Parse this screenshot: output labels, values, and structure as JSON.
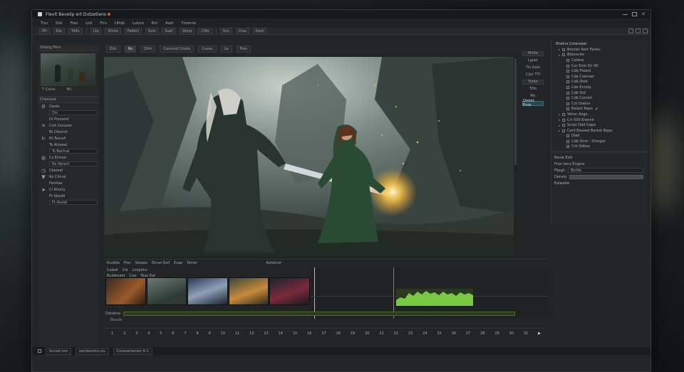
{
  "window": {
    "title": "Flevit Bevelip ert Dutzetiens"
  },
  "menu": [
    "Tlvs",
    "Sirk",
    "Ftes",
    "Lnd",
    "Ftrs",
    "Llfntb",
    "Lulzce",
    "Rnt",
    "Avet",
    "Tmenne"
  ],
  "toolbar": [
    "Pfr",
    "Ear",
    "Tofts",
    "Lta",
    "Dlvist",
    "Fedbrt",
    "Ssre",
    "Suer",
    "Qonp",
    "Ctlle",
    "Sns",
    "Ctse",
    "Dest"
  ],
  "left_panel": {
    "header": "Vilsing Pitro",
    "thumb_caption": [
      "T Cavle",
      "Bit"
    ],
    "section_title": "Chesrard",
    "rows": [
      {
        "icon": "settings-icon",
        "label": "Geole"
      },
      {
        "icon": "",
        "label": "Dis"
      },
      {
        "icon": "",
        "label": "Dl Prevaird"
      },
      {
        "icon": "wand-icon",
        "label": "Coit Cevazec"
      },
      {
        "icon": "",
        "label": "Bt Ditemrt"
      },
      {
        "icon": "refresh-icon",
        "label": "Rt Teorall"
      },
      {
        "icon": "",
        "label": "Ta Aloseet"
      },
      {
        "icon": "",
        "label": "Ts Bertnal"
      },
      {
        "icon": "chat-icon",
        "label": "Cs Eirtoal"
      },
      {
        "icon": "",
        "label": "Ro Sbrant"
      },
      {
        "icon": "clock-icon",
        "label": "Cbereel"
      },
      {
        "icon": "shield-icon",
        "label": "Ro Clirnal"
      },
      {
        "icon": "",
        "label": "Fenitaa"
      },
      {
        "icon": "pin-icon",
        "label": "Cl Ahorly"
      },
      {
        "icon": "",
        "label": "Ft Sbodd"
      },
      {
        "icon": "",
        "label": "Ft Aosist"
      }
    ]
  },
  "viewer": {
    "tabs": [
      "Edir",
      "Ro",
      "Dirtr",
      "Cannnid Cnatic",
      "Cavec",
      "Le",
      "Fres"
    ],
    "active_tab": 1
  },
  "tool_column": [
    "Pinite",
    "Lgoer",
    "Tiu Eavt",
    "Cjisr TTl",
    "Turso",
    "Tilfs",
    "Mx",
    "Dmmt Enre"
  ],
  "right_panel": {
    "header": "Ehehrs Cntersdet",
    "tree": [
      {
        "depth": 1,
        "label": "Brevier Aert Farets"
      },
      {
        "depth": 1,
        "label": "Bdevente"
      },
      {
        "depth": 2,
        "label": "Coldne"
      },
      {
        "depth": 2,
        "label": "Cor Eoio Str 40"
      },
      {
        "depth": 2,
        "label": "Cdb Fteeid"
      },
      {
        "depth": 2,
        "label": "Cde Coenser"
      },
      {
        "depth": 2,
        "label": "Cdb Dleit"
      },
      {
        "depth": 2,
        "label": "Cde Enroiq"
      },
      {
        "depth": 2,
        "label": "Cdb Did"
      },
      {
        "depth": 2,
        "label": "Cdb Corstel"
      },
      {
        "depth": 2,
        "label": "Cot Daelor"
      },
      {
        "depth": 2,
        "label": "Balant Baps",
        "check": true
      },
      {
        "depth": 1,
        "label": "Vehor Aoge"
      },
      {
        "depth": 1,
        "label": "Crr 500 Ereenit"
      },
      {
        "depth": 1,
        "label": "Snrpt Odd Dape"
      },
      {
        "depth": 1,
        "label": "Cent Eeseed Barest Bape"
      },
      {
        "depth": 2,
        "label": "Dlad"
      },
      {
        "depth": 2,
        "label": "Cdb Dnrn - Onsigor"
      },
      {
        "depth": 2,
        "label": "Cnt Ddbse"
      }
    ],
    "props": [
      {
        "label": "Bovle Eott",
        "kind": "text"
      },
      {
        "label": "Ftos Iienz Engine",
        "kind": "text"
      },
      {
        "label": "Fljegh",
        "kind": "field",
        "value": "Bortle"
      },
      {
        "label": "Derorp",
        "kind": "slider"
      },
      {
        "label": "Ealwetle",
        "kind": "text"
      }
    ]
  },
  "timeline": {
    "header": [
      "Eurdtie",
      "Frer",
      "Sdoate",
      "Ekner Eell",
      "Evae",
      "Tenier"
    ],
    "center_label": "Aotelnsir",
    "sub1": [
      "Coleel",
      "Cle",
      "Lnoptins"
    ],
    "sub2": [
      "Buideedet",
      "Coe",
      "Teas Eat"
    ],
    "bottom_label": "Detatisa",
    "bottom_sub": "Bessle",
    "ruler": [
      "1",
      "2",
      "3",
      "4",
      "5",
      "6",
      "7",
      "8",
      "9",
      "10",
      "11",
      "12",
      "13",
      "14",
      "15",
      "16",
      "17",
      "18",
      "19",
      "20",
      "21",
      "22",
      "23",
      "24",
      "25",
      "26",
      "27",
      "28",
      "29",
      "30",
      "31"
    ]
  },
  "status": {
    "items": [
      "Scruet oro",
      "oeicbenstrs.ou",
      "Coreoeriaroen 6:1"
    ]
  },
  "colors": {
    "accent": "#3f6a78",
    "audio": "#7ac943",
    "playhead": "#b6c96a"
  }
}
